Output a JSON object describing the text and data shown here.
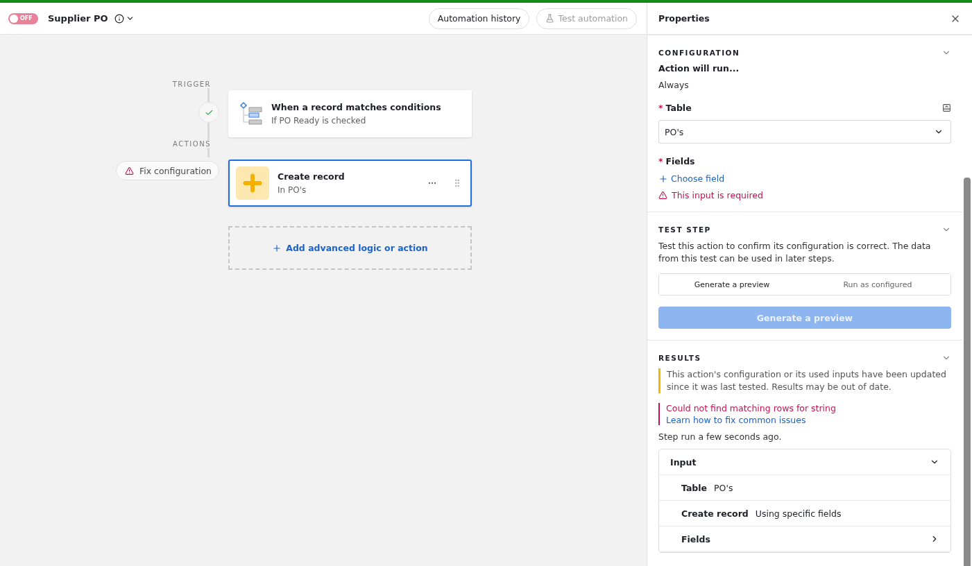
{
  "automation": {
    "enabled": false,
    "toggle_label": "OFF",
    "name": "Supplier PO"
  },
  "header_buttons": [
    {
      "label": "Automation history",
      "disabled": false,
      "kind": "history"
    },
    {
      "label": "Test automation",
      "disabled": true,
      "kind": "test"
    }
  ],
  "flow": {
    "trigger_label": "TRIGGER",
    "actions_label": "ACTIONS",
    "trigger": {
      "title": "When a record matches conditions",
      "subtitle": "If PO Ready is checked",
      "passed": true
    },
    "actions": [
      {
        "title": "Create record",
        "subtitle": "In PO's",
        "selected": true,
        "warning": "Fix configuration"
      }
    ],
    "add_label": "Add advanced logic or action"
  },
  "properties": {
    "title": "Properties",
    "configuration": {
      "heading": "CONFIGURATION",
      "run_label": "Action will run...",
      "run_value": "Always",
      "required_mark": "*",
      "table_label": "Table",
      "table_value": "PO's",
      "fields_label": "Fields",
      "choose_field": "Choose field",
      "error": "This input is required"
    },
    "test_step": {
      "heading": "TEST STEP",
      "description": "Test this action to confirm its configuration is correct. The data from this test can be used in later steps.",
      "modes": [
        {
          "label": "Generate a preview",
          "selected": true
        },
        {
          "label": "Run as configured",
          "selected": false
        }
      ],
      "button": {
        "label": "Generate a preview",
        "disabled": true
      }
    },
    "results": {
      "heading": "RESULTS",
      "notice": "This action's configuration or its used inputs have been updated since it was last tested. Results may be out of date.",
      "error": "Could not find matching rows for string",
      "error_link": "Learn how to fix common issues",
      "step_run": "Step run a few seconds ago.",
      "input": {
        "title": "Input",
        "expanded": true,
        "rows": [
          {
            "kind": "pair",
            "label": "Table",
            "value": "PO's"
          },
          {
            "kind": "pair",
            "label": "Create record",
            "value": "Using specific fields"
          },
          {
            "kind": "nested",
            "label": "Fields"
          }
        ]
      }
    }
  }
}
